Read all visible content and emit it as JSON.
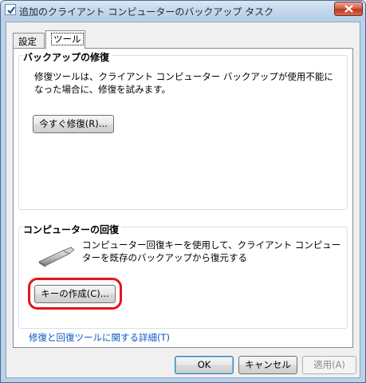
{
  "window": {
    "title": "追加のクライアント コンピューターのバックアップ タスク"
  },
  "tabs": [
    {
      "label": "設定"
    },
    {
      "label": "ツール"
    }
  ],
  "repair_group": {
    "title": "バックアップの修復",
    "description": "修復ツールは、クライアント コンピューター バックアップが使用不能になった場合に、修復を試みます。",
    "button_label": "今すぐ修復(R)..."
  },
  "recovery_group": {
    "title": "コンピューターの回復",
    "description": "コンピューター回復キーを使用して、クライアント コンピューターを既存のバックアップから復元する",
    "button_label": "キーの作成(C)..."
  },
  "link": {
    "label": "修復と回復ツールに関する詳細(T)"
  },
  "footer": {
    "ok_label": "OK",
    "cancel_label": "キャンセル",
    "apply_label": "適用(A)"
  },
  "colors": {
    "highlight": "#e8141b",
    "link": "#0b55c4"
  },
  "icons": {
    "title": "checkbox-icon",
    "close": "close-icon",
    "usb": "usb-drive-icon"
  }
}
